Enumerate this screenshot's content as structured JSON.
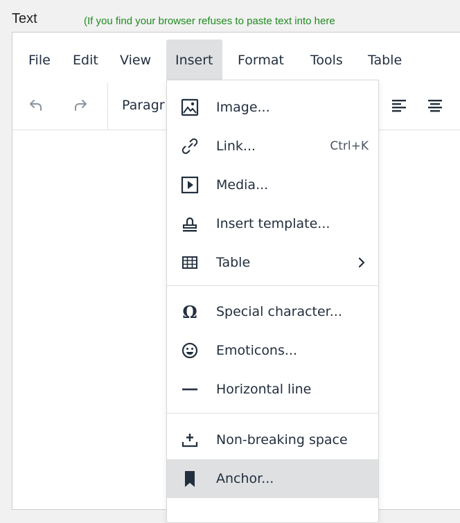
{
  "field": {
    "label": "Text",
    "hint": "(If you find your browser refuses to paste text into here"
  },
  "menubar": {
    "items": [
      {
        "label": "File"
      },
      {
        "label": "Edit"
      },
      {
        "label": "View"
      },
      {
        "label": "Insert",
        "active": true
      },
      {
        "label": "Format"
      },
      {
        "label": "Tools"
      },
      {
        "label": "Table"
      }
    ]
  },
  "toolbar": {
    "undo_icon": "undo-icon",
    "redo_icon": "redo-icon",
    "block_format_value": "Paragr",
    "align_left_icon": "align-left-icon",
    "align_center_icon": "align-center-icon"
  },
  "insert_menu": {
    "items": [
      {
        "label": "Image...",
        "icon": "image-icon"
      },
      {
        "label": "Link...",
        "shortcut": "Ctrl+K",
        "icon": "link-icon"
      },
      {
        "label": "Media...",
        "icon": "media-icon"
      },
      {
        "label": "Insert template...",
        "icon": "template-icon"
      },
      {
        "label": "Table",
        "icon": "table-icon",
        "submenu": true
      },
      {
        "label": "Special character...",
        "icon": "omega-icon"
      },
      {
        "label": "Emoticons...",
        "icon": "emoticon-icon"
      },
      {
        "label": "Horizontal line",
        "icon": "horizontal-line-icon"
      },
      {
        "label": "Non-breaking space",
        "icon": "nbsp-icon"
      },
      {
        "label": "Anchor...",
        "icon": "bookmark-icon",
        "highlighted": true
      }
    ]
  },
  "colors": {
    "hint_text": "#1f8a1f",
    "menu_active_bg": "#dee0e2",
    "text": "#222f3e"
  }
}
